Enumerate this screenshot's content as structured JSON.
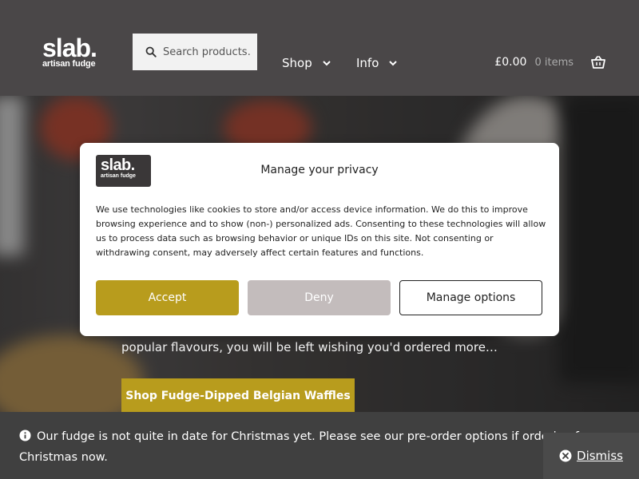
{
  "header": {
    "logo": {
      "main": "slab.",
      "sub": "artisan fudge"
    },
    "search": {
      "placeholder": "Search products…"
    },
    "nav": [
      {
        "label": "Shop"
      },
      {
        "label": "Info"
      }
    ],
    "cart": {
      "amount": "£0.00",
      "count": "0 items"
    }
  },
  "hero": {
    "text": "popular flavours, you will be left wishing you'd ordered more…",
    "button_label": "Shop Fudge-Dipped Belgian Waffles"
  },
  "privacy_modal": {
    "logo": {
      "main": "slab.",
      "sub": "artisan fudge"
    },
    "title": "Manage your privacy",
    "body": "We use technologies like cookies to store and/or access device information. We do this to improve browsing experience and to show (non-) personalized ads. Consenting to these technologies will allow us to process data such as browsing behavior or unique IDs on this site. Not consenting or withdrawing consent, may adversely affect certain features and functions.",
    "accept_label": "Accept",
    "deny_label": "Deny",
    "manage_label": "Manage options"
  },
  "store_notice": {
    "text": "Our fudge is not quite in date for Christmas yet. Please see our pre-order options if ordering for Christmas now.",
    "dismiss_label": "Dismiss"
  },
  "colors": {
    "header_bg": "#4a4748",
    "accent": "#b89c1d",
    "deny_bg": "#c3bcbc",
    "notice_bg": "#404040"
  },
  "icons": [
    "search-icon",
    "chevron-down-icon",
    "basket-icon",
    "info-icon",
    "close-icon"
  ]
}
